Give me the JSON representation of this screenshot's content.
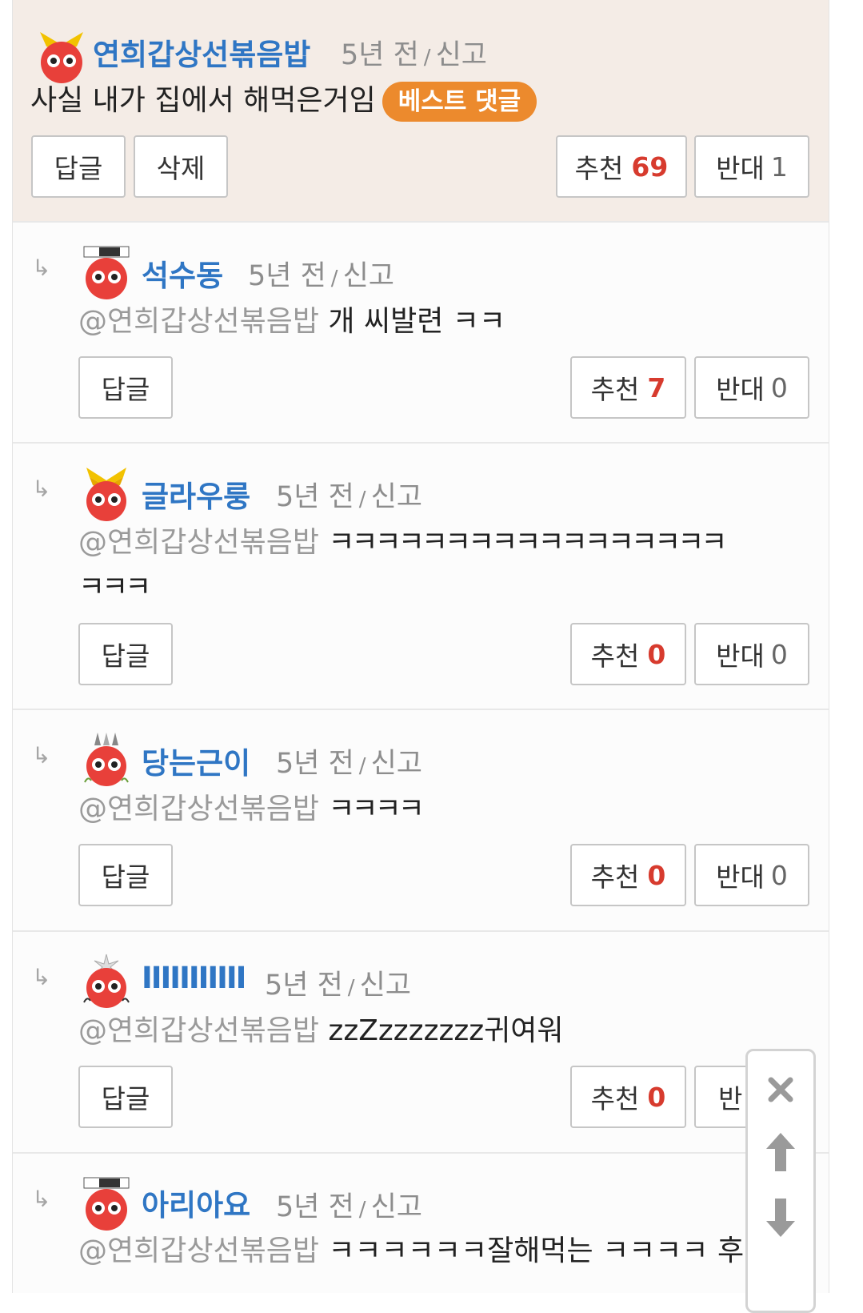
{
  "comments": [
    {
      "nick": "연희갑상선볶음밥",
      "time": "5년 전",
      "sep": "/",
      "report": "신고",
      "mention": "",
      "body": "사실 내가 집에서 해먹은거임",
      "body2": "",
      "badge": "베스트 댓글",
      "reply_label": "답글",
      "delete_label": "삭제",
      "up_label": "추천",
      "up_count": "69",
      "down_label": "반대",
      "down_count": "1"
    },
    {
      "nick": "석수동",
      "time": "5년 전",
      "sep": "/",
      "report": "신고",
      "mention": "@연희갑상선볶음밥",
      "body": "개 씨발련 ㅋㅋ",
      "body2": "",
      "reply_label": "답글",
      "up_label": "추천",
      "up_count": "7",
      "down_label": "반대",
      "down_count": "0"
    },
    {
      "nick": "글라우룽",
      "time": "5년 전",
      "sep": "/",
      "report": "신고",
      "mention": "@연희갑상선볶음밥",
      "body": "ㅋㅋㅋㅋㅋㅋㅋㅋㅋㅋㅋㅋㅋㅋㅋㅋㅋ",
      "body2": "ㅋㅋㅋ",
      "reply_label": "답글",
      "up_label": "추천",
      "up_count": "0",
      "down_label": "반대",
      "down_count": "0"
    },
    {
      "nick": "당는근이",
      "time": "5년 전",
      "sep": "/",
      "report": "신고",
      "mention": "@연희갑상선볶음밥",
      "body": "ㅋㅋㅋㅋ",
      "body2": "",
      "reply_label": "답글",
      "up_label": "추천",
      "up_count": "0",
      "down_label": "반대",
      "down_count": "0"
    },
    {
      "nick": "IIIIIIIIIII",
      "time": "5년 전",
      "sep": "/",
      "report": "신고",
      "mention": "@연희갑상선볶음밥",
      "body": "zzZzzzzzzz귀여워",
      "body2": "",
      "reply_label": "답글",
      "up_label": "추천",
      "up_count": "0",
      "down_label": "반",
      "down_count": ""
    },
    {
      "nick": "아리아요",
      "time": "5년 전",
      "sep": "/",
      "report": "신고",
      "mention": "@연희갑상선볶음밥",
      "body": "ㅋㅋㅋㅋㅋㅋ잘해먹는 ㅋㅋㅋㅋ 후",
      "body2": "",
      "reply_label": "",
      "up_label": "",
      "up_count": "",
      "down_label": "",
      "down_count": ""
    }
  ],
  "floating": {
    "close_icon": "close-icon",
    "up_icon": "arrow-up-icon",
    "down_icon": "arrow-down-icon"
  },
  "colors": {
    "nick": "#2f76c4",
    "badge": "#ec8a2d",
    "up_count": "#d73b2e",
    "best_bg": "#f4ece6"
  }
}
